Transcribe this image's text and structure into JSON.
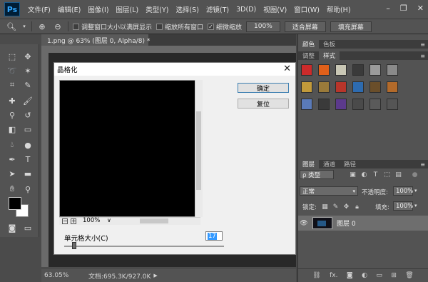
{
  "app": {
    "logo": "Ps"
  },
  "menu": [
    "文件(F)",
    "编辑(E)",
    "图像(I)",
    "图层(L)",
    "类型(Y)",
    "选择(S)",
    "滤镜(T)",
    "3D(D)",
    "视图(V)",
    "窗口(W)",
    "帮助(H)"
  ],
  "window_controls": {
    "minimize": "–",
    "restore": "❐",
    "close": "✕"
  },
  "options": {
    "resize_windows": "调整窗口大小以满屏显示",
    "zoom_all": "缩放所有窗口",
    "scrubby_zoom": "细微缩放",
    "btn_100": "100%",
    "btn_fit": "适合屏幕",
    "btn_fill": "填充屏幕"
  },
  "document": {
    "tab_title": "1.png @ 63% (图层 0, Alpha/8) *",
    "zoom": "63.05%",
    "info": "文档:695.3K/927.0K"
  },
  "dialog": {
    "title": "晶格化",
    "ok": "确定",
    "reset": "复位",
    "preview_zoom": "100%",
    "zoom_out": "−",
    "zoom_in": "+",
    "cell_size_label": "单元格大小(C)",
    "cell_size_value": "17",
    "cell_slider": {
      "value": 17,
      "min": 3,
      "max": 300
    }
  },
  "panels": {
    "top_tabs": [
      "颜色",
      "色板"
    ],
    "style_tabs": [
      "调整",
      "样式"
    ],
    "layer_tabs": [
      "图层",
      "通道",
      "路径"
    ],
    "filter_kind": "ρ 类型",
    "blend_mode": "正常",
    "opacity_label": "不透明度:",
    "opacity_value": "100%",
    "lock_label": "锁定:",
    "fill_label": "填充:",
    "fill_value": "100%",
    "layer_name": "图层 0",
    "footer_fx": "fx."
  },
  "style_swatches": [
    "#cc2b2b",
    "#e0601a",
    "#c9c7b5",
    "#3a3a3a",
    "#9a9a9a",
    "#8a8a8a",
    "#c29a3a",
    "#9a7a3a",
    "#b8352a",
    "#2d6bb0",
    "#6a4e2a",
    "#b36a2a",
    "#5a7ab8",
    "#3a3a3a",
    "#5c3a8c",
    "#4a4a4a",
    "#5a5a5a",
    "#555555"
  ]
}
